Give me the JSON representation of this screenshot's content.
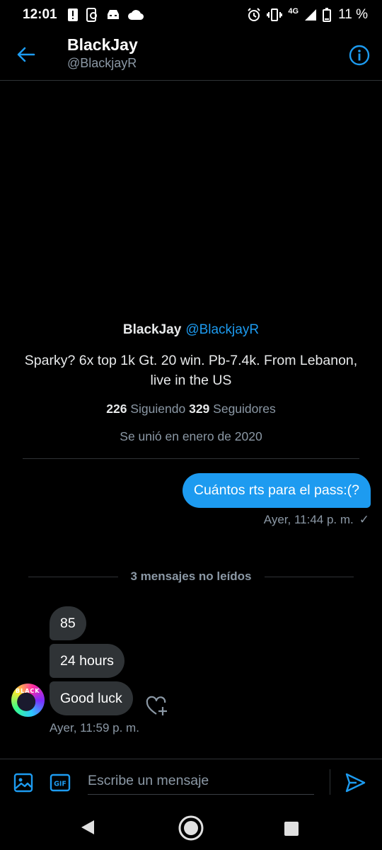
{
  "status_bar": {
    "time": "12:01",
    "network": "4G",
    "battery_percent": "11 %"
  },
  "header": {
    "name": "BlackJay",
    "handle": "@BlackjayR"
  },
  "profile": {
    "name": "BlackJay",
    "handle": "@BlackjayR",
    "bio": "Sparky? 6x top 1k Gt. 20 win. Pb-7.4k. From Lebanon, live in the US",
    "following_count": "226",
    "following_label": "Siguiendo",
    "followers_count": "329",
    "followers_label": "Seguidores",
    "joined": "Se unió en enero de 2020"
  },
  "conversation": {
    "sent": {
      "text": "Cuántos rts para el pass:(?",
      "timestamp": "Ayer, 11:44 p. m.",
      "status": "✓"
    },
    "unread_divider": "3 mensajes no leídos",
    "received": [
      {
        "text": "85"
      },
      {
        "text": "24 hours"
      },
      {
        "text": "Good luck"
      }
    ],
    "received_timestamp": "Ayer, 11:59 p. m.",
    "avatar_text": "BLACK"
  },
  "composer": {
    "placeholder": "Escribe un mensaje",
    "gif_label": "GIF"
  },
  "colors": {
    "accent": "#1d9bf0",
    "bubble_incoming": "#2f3336",
    "muted_text": "#8b98a5",
    "background": "#000000"
  }
}
